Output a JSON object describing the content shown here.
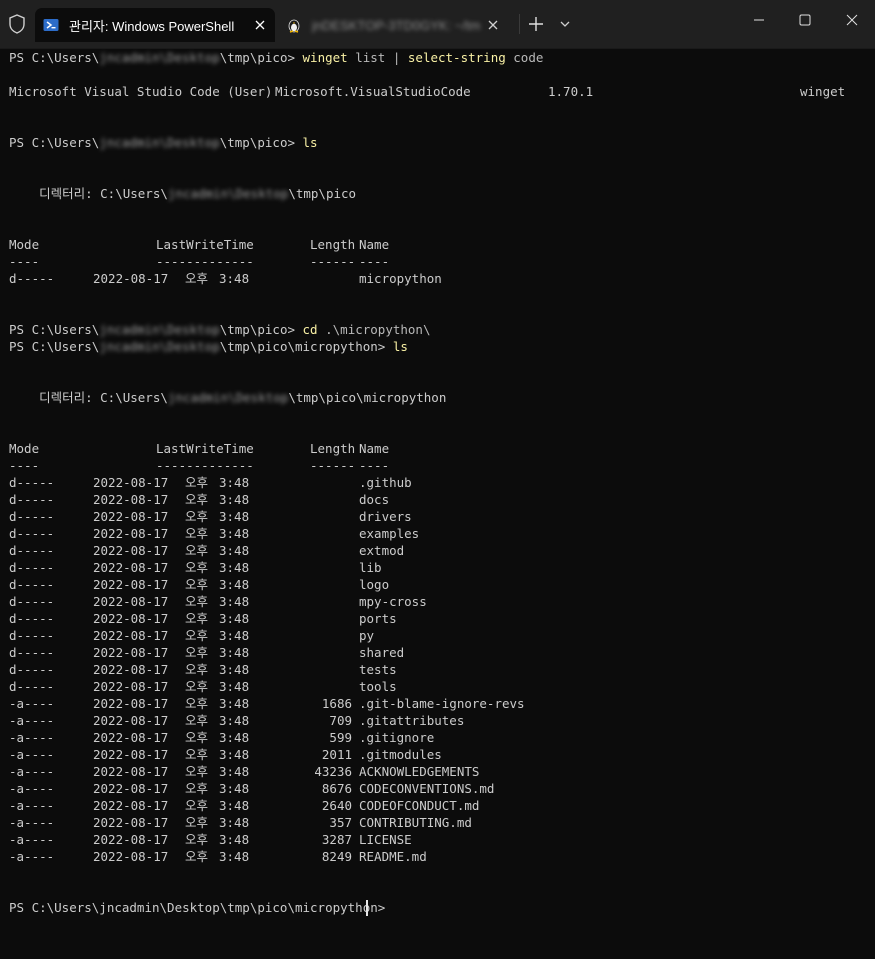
{
  "titlebar": {
    "active_tab_title": "관리자: Windows PowerShell",
    "inactive_tab_title": "jnDESKTOP-3TD0GYK: ~/tmp"
  },
  "colors": {
    "background": "#0c0c0c",
    "text": "#cccccc",
    "command": "#f9f1a5",
    "titlebar": "#202020"
  },
  "icons": {
    "shield": "shield-icon",
    "powershell": "powershell-icon",
    "linux": "tux-icon",
    "close": "close-icon",
    "new_tab": "plus-icon",
    "dropdown": "chevron-down-icon",
    "minimize": "minimize-icon",
    "maximize": "maximize-icon",
    "window_close": "window-close-icon"
  },
  "session": {
    "cmd1": {
      "prompt_pre": "PS C:\\Users\\",
      "user": "jncadmin\\Desktop",
      "prompt_post": "\\tmp\\pico>",
      "command": "winget",
      "args": "list | ",
      "command2": "select-string",
      "args2": "code"
    },
    "winget_result": {
      "name": "Microsoft Visual Studio Code (User)",
      "id": "Microsoft.VisualStudioCode",
      "version": "1.70.1",
      "source": "winget"
    },
    "cmd2": {
      "prompt_pre": "PS C:\\Users\\",
      "user": "jncadmin\\Desktop",
      "prompt_post": "\\tmp\\pico>",
      "command": "ls"
    },
    "dir1": {
      "label_pre": "    디렉터리: C:\\Users\\",
      "user": "jncadmin\\Desktop",
      "label_post": "\\tmp\\pico"
    },
    "headers": {
      "mode": "Mode",
      "lastwrite": "LastWriteTime",
      "length": "Length",
      "name": "Name",
      "mode_u": "----",
      "lastwrite_u": "-------------",
      "length_u": "------",
      "name_u": "----"
    },
    "listing1": [
      {
        "mode": "d-----",
        "date": "2022-08-17",
        "ampm": "오후",
        "time": "3:48",
        "length": "",
        "name": "micropython"
      }
    ],
    "cmd3": {
      "prompt_pre": "PS C:\\Users\\",
      "user": "jncadmin\\Desktop",
      "prompt_post": "\\tmp\\pico>",
      "command": "cd",
      "args": ".\\micropython\\"
    },
    "cmd4": {
      "prompt_pre": "PS C:\\Users\\",
      "user": "jncadmin\\Desktop",
      "prompt_post": "\\tmp\\pico\\micropython>",
      "command": "ls"
    },
    "dir2": {
      "label_pre": "    디렉터리: C:\\Users\\",
      "user": "jncadmin\\Desktop",
      "label_post": "\\tmp\\pico\\micropython"
    },
    "listing2": [
      {
        "mode": "d-----",
        "date": "2022-08-17",
        "ampm": "오후",
        "time": "3:48",
        "length": "",
        "name": ".github"
      },
      {
        "mode": "d-----",
        "date": "2022-08-17",
        "ampm": "오후",
        "time": "3:48",
        "length": "",
        "name": "docs"
      },
      {
        "mode": "d-----",
        "date": "2022-08-17",
        "ampm": "오후",
        "time": "3:48",
        "length": "",
        "name": "drivers"
      },
      {
        "mode": "d-----",
        "date": "2022-08-17",
        "ampm": "오후",
        "time": "3:48",
        "length": "",
        "name": "examples"
      },
      {
        "mode": "d-----",
        "date": "2022-08-17",
        "ampm": "오후",
        "time": "3:48",
        "length": "",
        "name": "extmod"
      },
      {
        "mode": "d-----",
        "date": "2022-08-17",
        "ampm": "오후",
        "time": "3:48",
        "length": "",
        "name": "lib"
      },
      {
        "mode": "d-----",
        "date": "2022-08-17",
        "ampm": "오후",
        "time": "3:48",
        "length": "",
        "name": "logo"
      },
      {
        "mode": "d-----",
        "date": "2022-08-17",
        "ampm": "오후",
        "time": "3:48",
        "length": "",
        "name": "mpy-cross"
      },
      {
        "mode": "d-----",
        "date": "2022-08-17",
        "ampm": "오후",
        "time": "3:48",
        "length": "",
        "name": "ports"
      },
      {
        "mode": "d-----",
        "date": "2022-08-17",
        "ampm": "오후",
        "time": "3:48",
        "length": "",
        "name": "py"
      },
      {
        "mode": "d-----",
        "date": "2022-08-17",
        "ampm": "오후",
        "time": "3:48",
        "length": "",
        "name": "shared"
      },
      {
        "mode": "d-----",
        "date": "2022-08-17",
        "ampm": "오후",
        "time": "3:48",
        "length": "",
        "name": "tests"
      },
      {
        "mode": "d-----",
        "date": "2022-08-17",
        "ampm": "오후",
        "time": "3:48",
        "length": "",
        "name": "tools"
      },
      {
        "mode": "-a----",
        "date": "2022-08-17",
        "ampm": "오후",
        "time": "3:48",
        "length": "1686",
        "name": ".git-blame-ignore-revs"
      },
      {
        "mode": "-a----",
        "date": "2022-08-17",
        "ampm": "오후",
        "time": "3:48",
        "length": "709",
        "name": ".gitattributes"
      },
      {
        "mode": "-a----",
        "date": "2022-08-17",
        "ampm": "오후",
        "time": "3:48",
        "length": "599",
        "name": ".gitignore"
      },
      {
        "mode": "-a----",
        "date": "2022-08-17",
        "ampm": "오후",
        "time": "3:48",
        "length": "2011",
        "name": ".gitmodules"
      },
      {
        "mode": "-a----",
        "date": "2022-08-17",
        "ampm": "오후",
        "time": "3:48",
        "length": "43236",
        "name": "ACKNOWLEDGEMENTS"
      },
      {
        "mode": "-a----",
        "date": "2022-08-17",
        "ampm": "오후",
        "time": "3:48",
        "length": "8676",
        "name": "CODECONVENTIONS.md"
      },
      {
        "mode": "-a----",
        "date": "2022-08-17",
        "ampm": "오후",
        "time": "3:48",
        "length": "2640",
        "name": "CODEOFCONDUCT.md"
      },
      {
        "mode": "-a----",
        "date": "2022-08-17",
        "ampm": "오후",
        "time": "3:48",
        "length": "357",
        "name": "CONTRIBUTING.md"
      },
      {
        "mode": "-a----",
        "date": "2022-08-17",
        "ampm": "오후",
        "time": "3:48",
        "length": "3287",
        "name": "LICENSE"
      },
      {
        "mode": "-a----",
        "date": "2022-08-17",
        "ampm": "오후",
        "time": "3:48",
        "length": "8249",
        "name": "README.md"
      }
    ],
    "final_prompt": "PS C:\\Users\\jncadmin\\Desktop\\tmp\\pico\\micropython>"
  }
}
